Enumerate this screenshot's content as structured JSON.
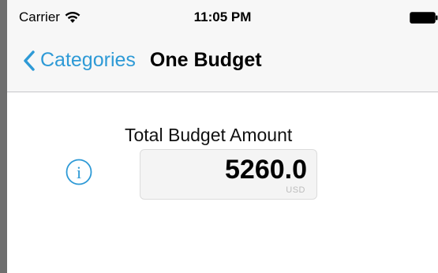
{
  "status_bar": {
    "carrier": "Carrier",
    "time": "11:05 PM",
    "wifi_icon": "wifi-icon",
    "battery_icon": "battery-icon"
  },
  "nav_bar": {
    "back_label": "Categories",
    "back_icon": "chevron-left-icon",
    "title": "One Budget"
  },
  "budget": {
    "label": "Total Budget Amount",
    "amount": "5260.0",
    "currency": "USD",
    "info_icon": "info-icon"
  },
  "colors": {
    "accent": "#2e9ad6",
    "bar_background": "#f7f7f7",
    "field_background": "#f4f4f4"
  }
}
